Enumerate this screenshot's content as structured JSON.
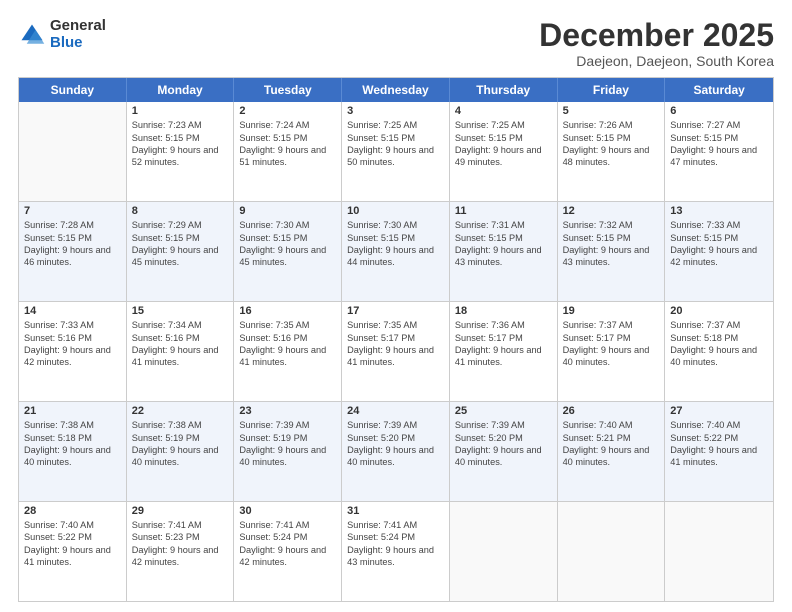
{
  "logo": {
    "general": "General",
    "blue": "Blue"
  },
  "title": "December 2025",
  "location": "Daejeon, Daejeon, South Korea",
  "days_header": [
    "Sunday",
    "Monday",
    "Tuesday",
    "Wednesday",
    "Thursday",
    "Friday",
    "Saturday"
  ],
  "rows": [
    [
      {
        "day": "",
        "sunrise": "",
        "sunset": "",
        "daylight": ""
      },
      {
        "day": "1",
        "sunrise": "Sunrise: 7:23 AM",
        "sunset": "Sunset: 5:15 PM",
        "daylight": "Daylight: 9 hours and 52 minutes."
      },
      {
        "day": "2",
        "sunrise": "Sunrise: 7:24 AM",
        "sunset": "Sunset: 5:15 PM",
        "daylight": "Daylight: 9 hours and 51 minutes."
      },
      {
        "day": "3",
        "sunrise": "Sunrise: 7:25 AM",
        "sunset": "Sunset: 5:15 PM",
        "daylight": "Daylight: 9 hours and 50 minutes."
      },
      {
        "day": "4",
        "sunrise": "Sunrise: 7:25 AM",
        "sunset": "Sunset: 5:15 PM",
        "daylight": "Daylight: 9 hours and 49 minutes."
      },
      {
        "day": "5",
        "sunrise": "Sunrise: 7:26 AM",
        "sunset": "Sunset: 5:15 PM",
        "daylight": "Daylight: 9 hours and 48 minutes."
      },
      {
        "day": "6",
        "sunrise": "Sunrise: 7:27 AM",
        "sunset": "Sunset: 5:15 PM",
        "daylight": "Daylight: 9 hours and 47 minutes."
      }
    ],
    [
      {
        "day": "7",
        "sunrise": "Sunrise: 7:28 AM",
        "sunset": "Sunset: 5:15 PM",
        "daylight": "Daylight: 9 hours and 46 minutes."
      },
      {
        "day": "8",
        "sunrise": "Sunrise: 7:29 AM",
        "sunset": "Sunset: 5:15 PM",
        "daylight": "Daylight: 9 hours and 45 minutes."
      },
      {
        "day": "9",
        "sunrise": "Sunrise: 7:30 AM",
        "sunset": "Sunset: 5:15 PM",
        "daylight": "Daylight: 9 hours and 45 minutes."
      },
      {
        "day": "10",
        "sunrise": "Sunrise: 7:30 AM",
        "sunset": "Sunset: 5:15 PM",
        "daylight": "Daylight: 9 hours and 44 minutes."
      },
      {
        "day": "11",
        "sunrise": "Sunrise: 7:31 AM",
        "sunset": "Sunset: 5:15 PM",
        "daylight": "Daylight: 9 hours and 43 minutes."
      },
      {
        "day": "12",
        "sunrise": "Sunrise: 7:32 AM",
        "sunset": "Sunset: 5:15 PM",
        "daylight": "Daylight: 9 hours and 43 minutes."
      },
      {
        "day": "13",
        "sunrise": "Sunrise: 7:33 AM",
        "sunset": "Sunset: 5:15 PM",
        "daylight": "Daylight: 9 hours and 42 minutes."
      }
    ],
    [
      {
        "day": "14",
        "sunrise": "Sunrise: 7:33 AM",
        "sunset": "Sunset: 5:16 PM",
        "daylight": "Daylight: 9 hours and 42 minutes."
      },
      {
        "day": "15",
        "sunrise": "Sunrise: 7:34 AM",
        "sunset": "Sunset: 5:16 PM",
        "daylight": "Daylight: 9 hours and 41 minutes."
      },
      {
        "day": "16",
        "sunrise": "Sunrise: 7:35 AM",
        "sunset": "Sunset: 5:16 PM",
        "daylight": "Daylight: 9 hours and 41 minutes."
      },
      {
        "day": "17",
        "sunrise": "Sunrise: 7:35 AM",
        "sunset": "Sunset: 5:17 PM",
        "daylight": "Daylight: 9 hours and 41 minutes."
      },
      {
        "day": "18",
        "sunrise": "Sunrise: 7:36 AM",
        "sunset": "Sunset: 5:17 PM",
        "daylight": "Daylight: 9 hours and 41 minutes."
      },
      {
        "day": "19",
        "sunrise": "Sunrise: 7:37 AM",
        "sunset": "Sunset: 5:17 PM",
        "daylight": "Daylight: 9 hours and 40 minutes."
      },
      {
        "day": "20",
        "sunrise": "Sunrise: 7:37 AM",
        "sunset": "Sunset: 5:18 PM",
        "daylight": "Daylight: 9 hours and 40 minutes."
      }
    ],
    [
      {
        "day": "21",
        "sunrise": "Sunrise: 7:38 AM",
        "sunset": "Sunset: 5:18 PM",
        "daylight": "Daylight: 9 hours and 40 minutes."
      },
      {
        "day": "22",
        "sunrise": "Sunrise: 7:38 AM",
        "sunset": "Sunset: 5:19 PM",
        "daylight": "Daylight: 9 hours and 40 minutes."
      },
      {
        "day": "23",
        "sunrise": "Sunrise: 7:39 AM",
        "sunset": "Sunset: 5:19 PM",
        "daylight": "Daylight: 9 hours and 40 minutes."
      },
      {
        "day": "24",
        "sunrise": "Sunrise: 7:39 AM",
        "sunset": "Sunset: 5:20 PM",
        "daylight": "Daylight: 9 hours and 40 minutes."
      },
      {
        "day": "25",
        "sunrise": "Sunrise: 7:39 AM",
        "sunset": "Sunset: 5:20 PM",
        "daylight": "Daylight: 9 hours and 40 minutes."
      },
      {
        "day": "26",
        "sunrise": "Sunrise: 7:40 AM",
        "sunset": "Sunset: 5:21 PM",
        "daylight": "Daylight: 9 hours and 40 minutes."
      },
      {
        "day": "27",
        "sunrise": "Sunrise: 7:40 AM",
        "sunset": "Sunset: 5:22 PM",
        "daylight": "Daylight: 9 hours and 41 minutes."
      }
    ],
    [
      {
        "day": "28",
        "sunrise": "Sunrise: 7:40 AM",
        "sunset": "Sunset: 5:22 PM",
        "daylight": "Daylight: 9 hours and 41 minutes."
      },
      {
        "day": "29",
        "sunrise": "Sunrise: 7:41 AM",
        "sunset": "Sunset: 5:23 PM",
        "daylight": "Daylight: 9 hours and 42 minutes."
      },
      {
        "day": "30",
        "sunrise": "Sunrise: 7:41 AM",
        "sunset": "Sunset: 5:24 PM",
        "daylight": "Daylight: 9 hours and 42 minutes."
      },
      {
        "day": "31",
        "sunrise": "Sunrise: 7:41 AM",
        "sunset": "Sunset: 5:24 PM",
        "daylight": "Daylight: 9 hours and 43 minutes."
      },
      {
        "day": "",
        "sunrise": "",
        "sunset": "",
        "daylight": ""
      },
      {
        "day": "",
        "sunrise": "",
        "sunset": "",
        "daylight": ""
      },
      {
        "day": "",
        "sunrise": "",
        "sunset": "",
        "daylight": ""
      }
    ]
  ]
}
